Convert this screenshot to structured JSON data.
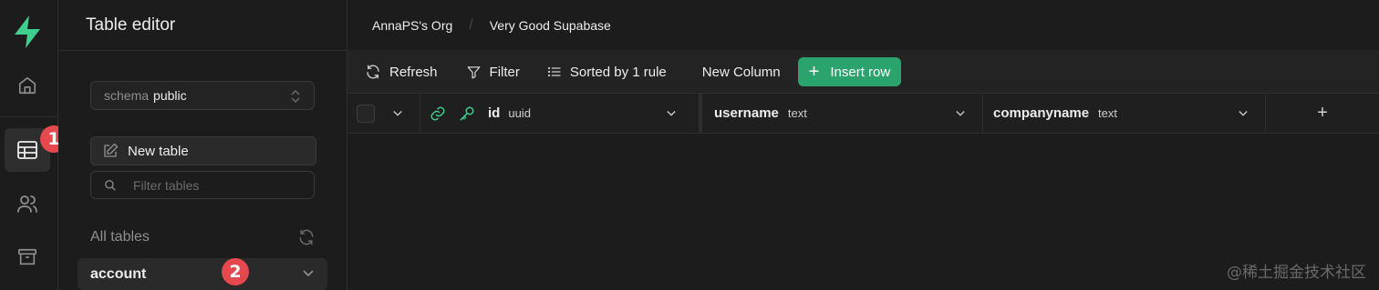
{
  "sidebar": {
    "title": "Table editor",
    "schema_prefix": "schema",
    "schema_value": "public",
    "new_table_label": "New table",
    "search_placeholder": "Filter tables",
    "all_tables_label": "All tables",
    "tables": [
      {
        "name": "account"
      }
    ]
  },
  "breadcrumb": {
    "org": "AnnaPS's Org",
    "project": "Very Good Supabase"
  },
  "toolbar": {
    "refresh_label": "Refresh",
    "filter_label": "Filter",
    "sort_label": "Sorted by 1 rule",
    "new_column_label": "New Column",
    "insert_row_label": "Insert row"
  },
  "columns": [
    {
      "name": "id",
      "type": "uuid"
    },
    {
      "name": "username",
      "type": "text"
    },
    {
      "name": "companyname",
      "type": "text"
    }
  ],
  "add_column_symbol": "+",
  "annotations": {
    "badge_1": "1",
    "badge_2": "2"
  },
  "watermark": "@稀土掘金技术社区",
  "colors": {
    "accent": "#2aa36c",
    "badge": "#e5484d",
    "background": "#1c1c1c"
  },
  "icons": [
    "supabase-logo-icon",
    "home-icon",
    "table-editor-icon",
    "users-icon",
    "archive-icon",
    "edit-icon",
    "search-icon",
    "refresh-icon",
    "filter-icon",
    "sort-icon",
    "link-icon",
    "key-icon",
    "chevron-down-icon",
    "plus-icon"
  ]
}
